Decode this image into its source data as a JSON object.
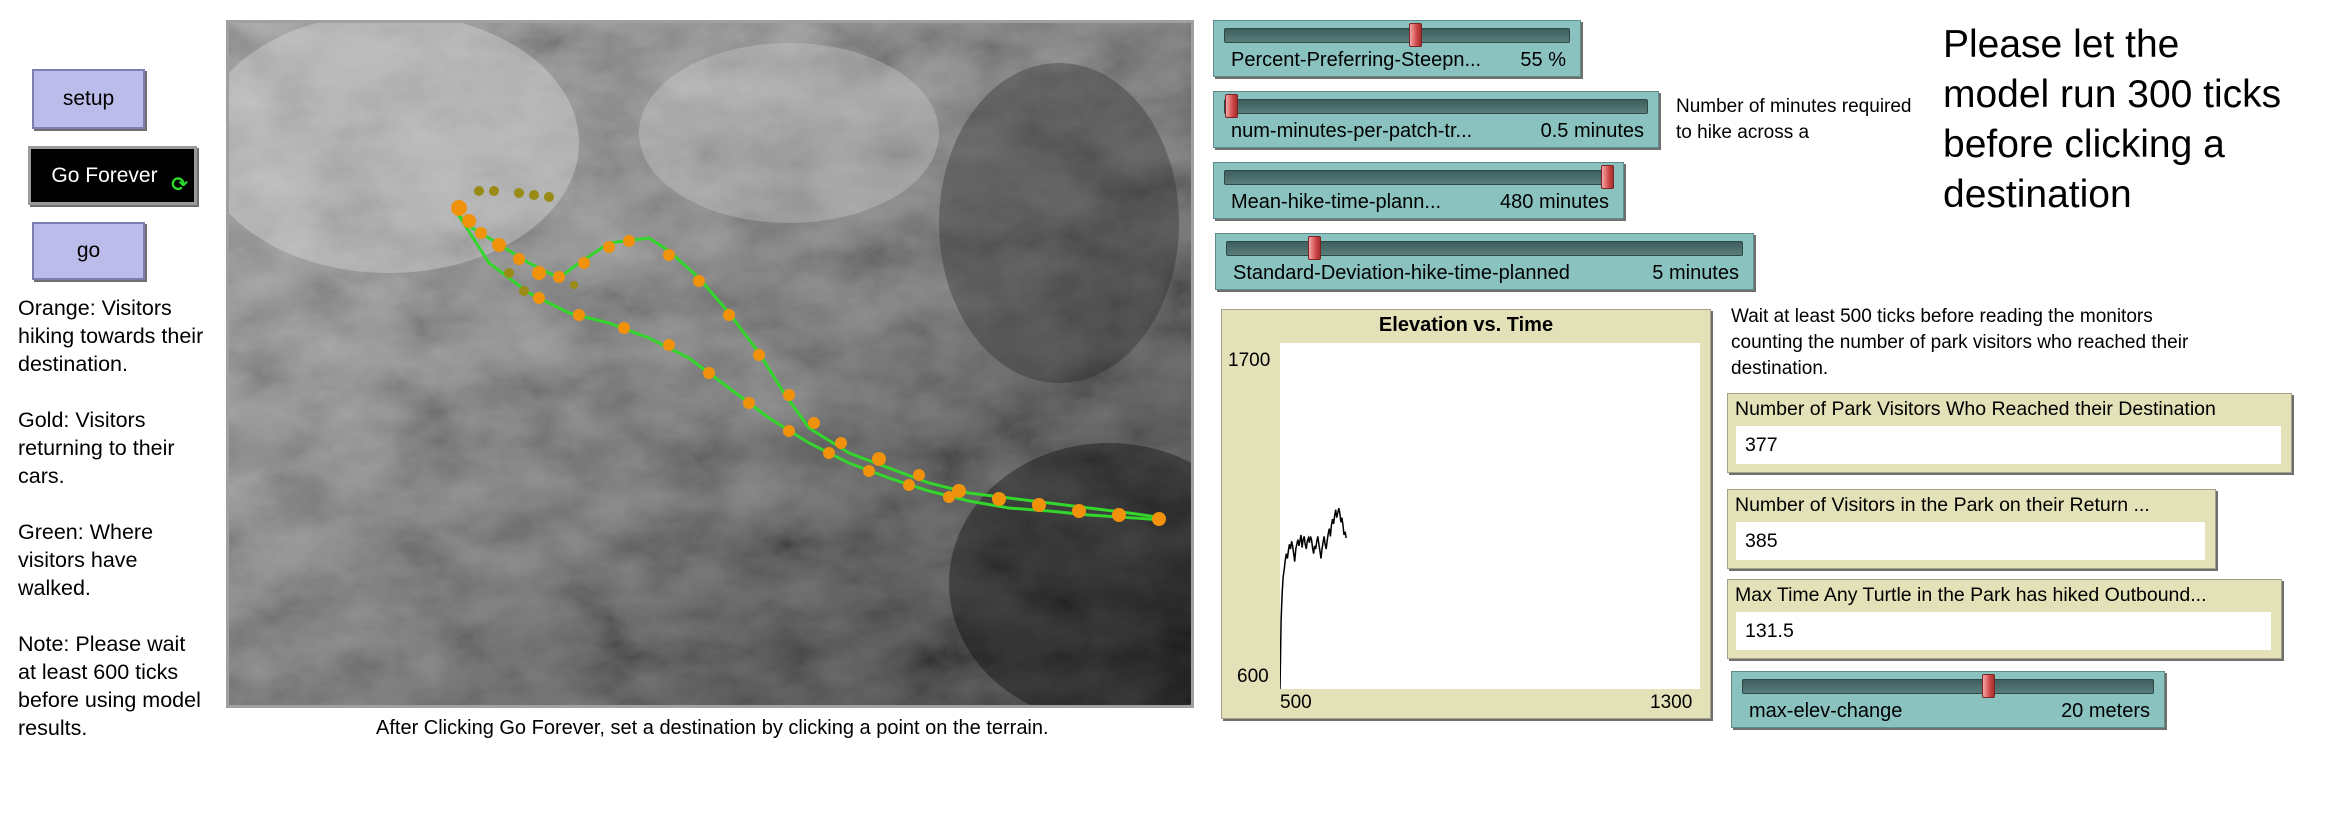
{
  "buttons": {
    "setup": "setup",
    "go_forever": "Go Forever",
    "go": "go"
  },
  "notes": {
    "orange": "Orange: Visitors hiking towards their destination.",
    "gold": "Gold: Visitors returning to their cars.",
    "green": "Green: Where visitors have walked.",
    "note": "Note: Please wait at least 600 ticks before using model results."
  },
  "view": {
    "caption": "After Clicking Go Forever, set a destination by clicking a point on the terrain.",
    "colors": {
      "orange_hikers": "#f0920c",
      "gold_hikers": "#9a8a16",
      "green_trail": "#33d62a"
    }
  },
  "sliders": [
    {
      "label": "Percent-Preferring-Steepn...",
      "value": "55 %",
      "fraction": 0.55
    },
    {
      "label": "num-minutes-per-patch-tr...",
      "value": "0.5 minutes",
      "fraction": 0.0
    },
    {
      "label": "Mean-hike-time-plann...",
      "value": "480 minutes",
      "fraction": 1.0
    },
    {
      "label": "Standard-Deviation-hike-time-planned",
      "value": "5 minutes",
      "fraction": 0.16
    },
    {
      "label": "max-elev-change",
      "value": "20 meters",
      "fraction": 0.6
    }
  ],
  "notes_right": {
    "minutes_note": "Number of minutes required to hike across a",
    "wait_note": "Wait at least 500 ticks before reading the monitors counting the number of park visitors who reached their destination.",
    "big_note": "Please let the model run 300 ticks before clicking a destination"
  },
  "chart_data": {
    "type": "line",
    "title": "Elevation vs. Time",
    "xlabel": "",
    "ylabel": "",
    "x_min_label": "500",
    "x_max_label": "1300",
    "y_max_label": "1700",
    "y_min_label": "600",
    "xlim": [
      500,
      1300
    ],
    "ylim": [
      600,
      1700
    ],
    "series": [
      {
        "color": "#000000",
        "x": [
          500,
          502,
          504,
          506,
          508,
          510,
          512,
          514,
          516,
          518,
          520,
          522,
          524,
          526,
          528,
          530,
          532,
          534,
          536,
          538,
          540,
          542,
          544,
          546,
          548,
          550,
          552,
          554,
          556,
          558,
          560,
          562,
          564,
          566,
          568,
          570,
          572,
          574,
          576,
          578,
          580,
          582,
          584,
          586,
          588,
          590,
          592,
          594,
          596,
          598,
          600,
          602,
          604,
          606,
          608,
          610,
          612,
          614,
          616,
          618,
          620,
          622,
          624,
          626
        ],
        "y": [
          600,
          820,
          900,
          955,
          980,
          1010,
          1030,
          1015,
          1040,
          1060,
          1045,
          1070,
          1055,
          1030,
          1005,
          1045,
          1060,
          1075,
          1055,
          1070,
          1090,
          1050,
          1075,
          1085,
          1060,
          1045,
          1070,
          1080,
          1065,
          1085,
          1075,
          1050,
          1030,
          1055,
          1045,
          1070,
          1085,
          1060,
          1040,
          1015,
          1045,
          1065,
          1085,
          1060,
          1045,
          1075,
          1095,
          1110,
          1085,
          1120,
          1140,
          1125,
          1150,
          1170,
          1145,
          1160,
          1175,
          1160,
          1130,
          1145,
          1120,
          1090,
          1100,
          1080
        ]
      }
    ]
  },
  "monitors": [
    {
      "label": "Number of Park Visitors Who Reached their Destination",
      "value": "377"
    },
    {
      "label": "Number of Visitors in the Park on their Return ...",
      "value": "385"
    },
    {
      "label": "Max Time Any Turtle in the Park has hiked Outbound...",
      "value": "131.5"
    }
  ]
}
